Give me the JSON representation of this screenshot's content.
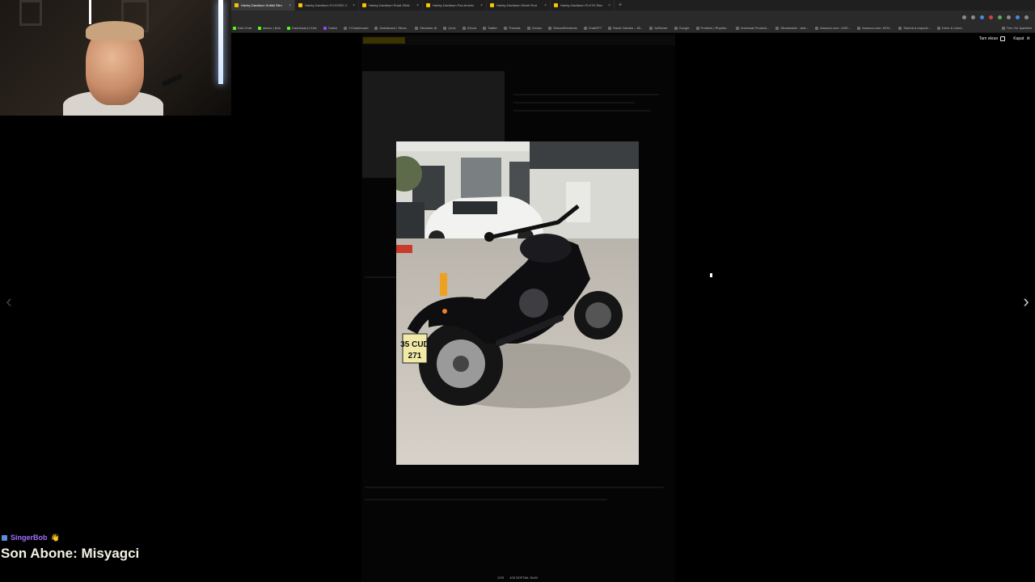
{
  "browser": {
    "tabs": [
      {
        "label": "Harley-Davidson Softail Slim"
      },
      {
        "label": "Harley-Davidson FLHXSE2 C"
      },
      {
        "label": "Harley-Davidson Road Glide"
      },
      {
        "label": "Harley-Davidson Pan Americ"
      },
      {
        "label": "Harley-Davidson Street Rod"
      },
      {
        "label": "Harley-Davidson FLHTK Elec"
      }
    ],
    "new_tab": "+",
    "bookmarks": [
      {
        "label": "Kick Chat"
      },
      {
        "label": "sisnac | Kick"
      },
      {
        "label": "Dashboard | Kick"
      },
      {
        "label": "Twitch"
      },
      {
        "label": "Yt Dashboard"
      },
      {
        "label": "Dashboard / Strea..."
      },
      {
        "label": "Streamer AI"
      },
      {
        "label": "Çevir"
      },
      {
        "label": "iCloud"
      },
      {
        "label": "Twitter"
      },
      {
        "label": "Threads"
      },
      {
        "label": "Oculus"
      },
      {
        "label": "StreamElements"
      },
      {
        "label": "ChatGPT"
      },
      {
        "label": "Radio Garden – Kli..."
      },
      {
        "label": "AdSense"
      },
      {
        "label": "Google"
      },
      {
        "label": "Portfolio | Rhythm..."
      },
      {
        "label": "Universal Producti..."
      },
      {
        "label": "Streamable - vide..."
      },
      {
        "label": "Amazon.com: LIGE..."
      },
      {
        "label": "Amazon.com: NOV..."
      },
      {
        "label": "Submit a request..."
      },
      {
        "label": "Drive & Listen"
      }
    ],
    "all_bookmarks": "Tüm Yer İşaretleri"
  },
  "lightbox": {
    "fullscreen_label": "Tam ekran",
    "close_label": "Kapat",
    "counter": "2/23",
    "caption": "103 SOFTAIL SLIM",
    "prev_glyph": "‹",
    "next_glyph": "›"
  },
  "photo": {
    "plate_line1": "35 CUD",
    "plate_line2": "271"
  },
  "stream": {
    "chat_user": "SingerBob",
    "chat_emote": "👋",
    "last_sub_label": "Son Abone: Misyagci"
  }
}
